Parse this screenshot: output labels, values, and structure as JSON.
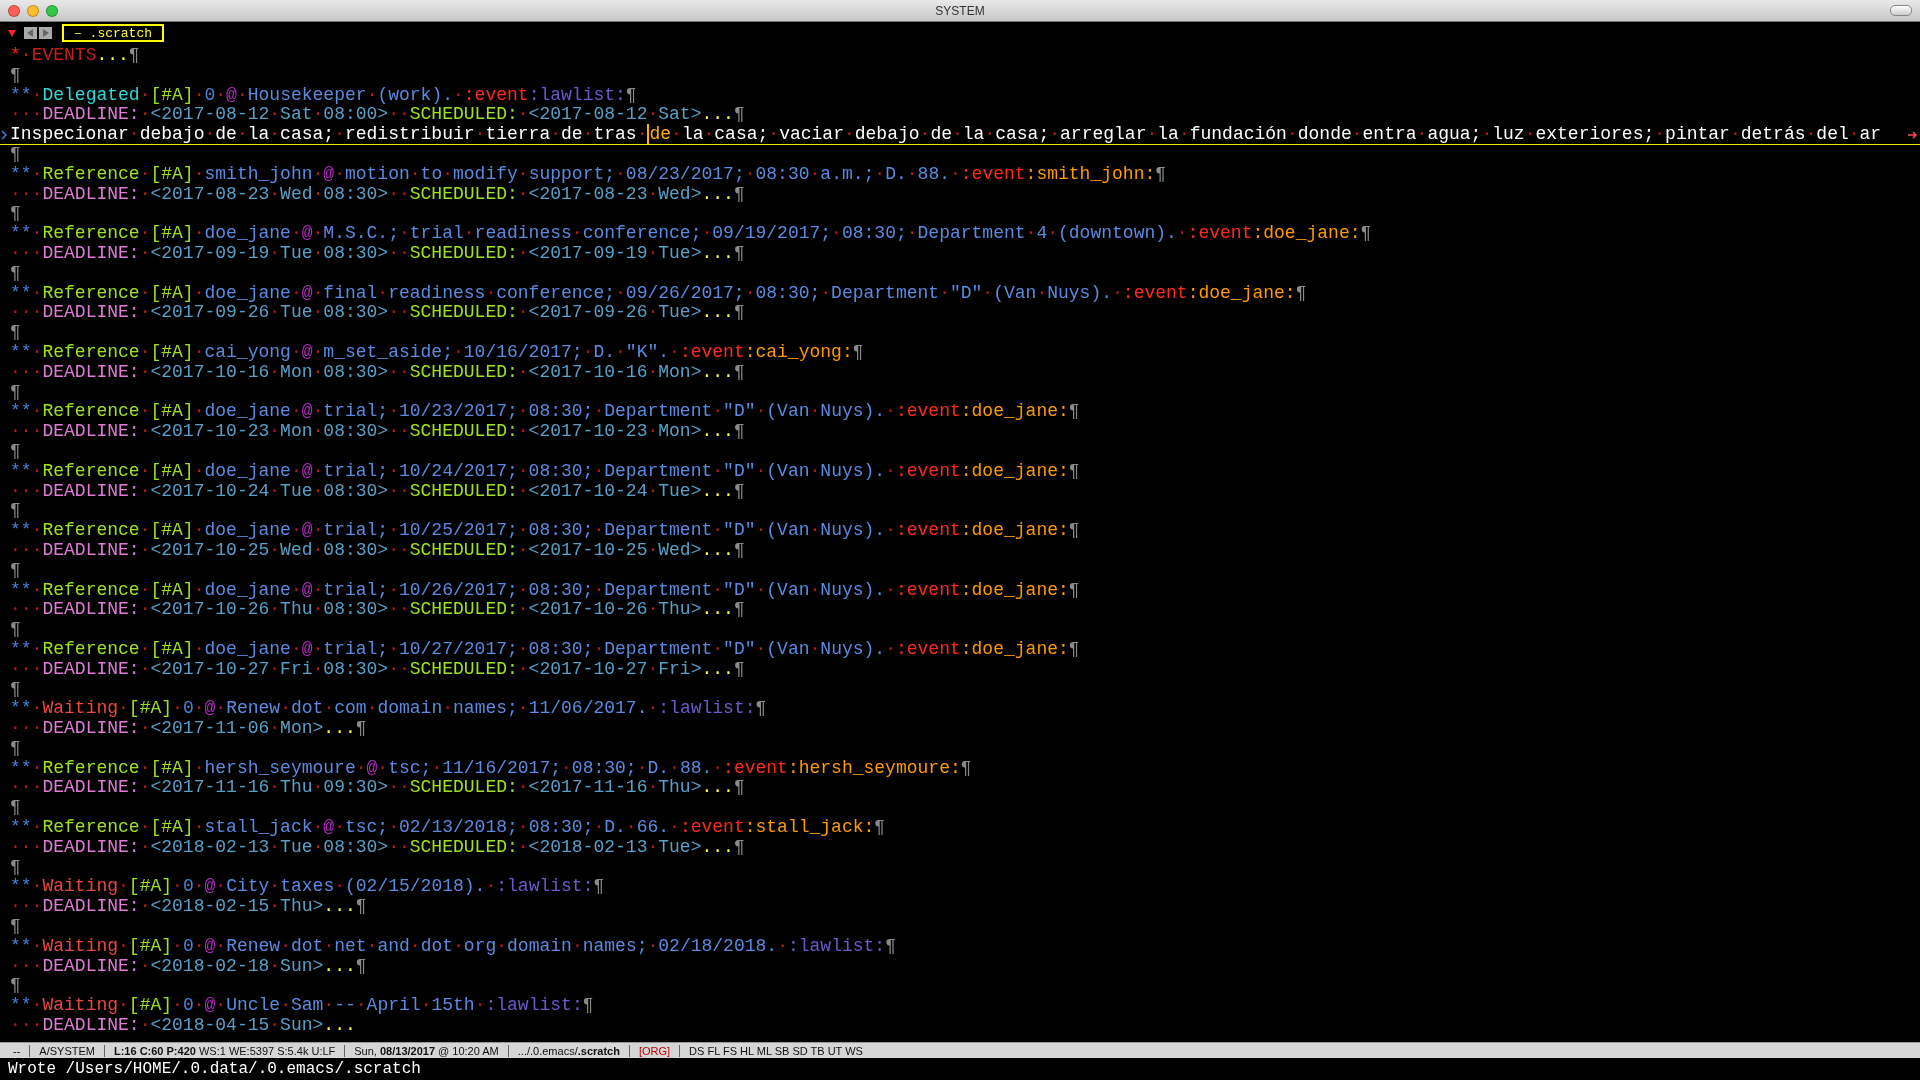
{
  "window": {
    "title": "SYSTEM"
  },
  "tab": {
    "label": "– .scratch",
    "selected": true
  },
  "lines": [
    {
      "kind": "heading",
      "segments": [
        {
          "kind": "star",
          "text": "*·"
        },
        {
          "kind": "events",
          "text": "EVENTS"
        },
        {
          "kind": "ellipsis",
          "text": "..."
        },
        {
          "kind": "pilcrow",
          "text": "¶"
        }
      ]
    },
    {
      "kind": "blank",
      "segments": [
        {
          "kind": "pilcrow",
          "text": "¶"
        }
      ]
    },
    {
      "kind": "heading",
      "segments": [
        {
          "kind": "stars",
          "text": "**·"
        },
        {
          "kind": "delegated",
          "text": "Delegated·"
        },
        {
          "kind": "priority",
          "text": "[#A]·"
        },
        {
          "kind": "count",
          "text": "0·"
        },
        {
          "kind": "at",
          "text": "@·"
        },
        {
          "kind": "title",
          "text": "Housekeeper·(work).·"
        },
        {
          "kind": "tag_event",
          "text": ":event"
        },
        {
          "kind": "tag_list",
          "text": ":lawlist:"
        },
        {
          "kind": "pilcrow",
          "text": "¶"
        }
      ]
    },
    {
      "kind": "planning",
      "segments": [
        {
          "kind": "indent",
          "text": "···"
        },
        {
          "kind": "deadline",
          "text": "DEADLINE:·"
        },
        {
          "kind": "timestamp",
          "text": "<2017-08-12·Sat·08:00>··"
        },
        {
          "kind": "scheduled",
          "text": "SCHEDULED:·"
        },
        {
          "kind": "timestamp",
          "text": "<2017-08-12·Sat>"
        },
        {
          "kind": "ellipsis",
          "text": "..."
        },
        {
          "kind": "pilcrow",
          "text": "¶"
        }
      ]
    },
    {
      "kind": "body",
      "segments": [
        {
          "kind": "body",
          "text": "Inspecionar·debajo·de·la·casa;·redistribuir·tierra·de·tras·"
        },
        {
          "kind": "cursor",
          "text": "de"
        },
        {
          "kind": "body",
          "text": "·la·casa;·vaciar·debajo·de·la·casa;·arreglar·la·fundación·donde·entra·agua;·luz·exteriores;·pintar·detrás·del·ar"
        }
      ]
    },
    {
      "kind": "blank",
      "segments": [
        {
          "kind": "pilcrow",
          "text": "¶"
        }
      ]
    },
    {
      "kind": "heading",
      "segments": [
        {
          "kind": "stars",
          "text": "**·"
        },
        {
          "kind": "reference",
          "text": "Reference·"
        },
        {
          "kind": "priority",
          "text": "[#A]·"
        },
        {
          "kind": "person",
          "text": "smith_john·"
        },
        {
          "kind": "at",
          "text": "@·"
        },
        {
          "kind": "title",
          "text": "motion·to·modify·support;·08/23/2017;·08:30·a.m.;·D.·88.·"
        },
        {
          "kind": "tag_event",
          "text": ":event"
        },
        {
          "kind": "tag_name",
          "text": ":smith_john:"
        },
        {
          "kind": "pilcrow",
          "text": "¶"
        }
      ]
    },
    {
      "kind": "planning",
      "segments": [
        {
          "kind": "indent",
          "text": "···"
        },
        {
          "kind": "deadline",
          "text": "DEADLINE:·"
        },
        {
          "kind": "timestamp",
          "text": "<2017-08-23·Wed·08:30>··"
        },
        {
          "kind": "scheduled",
          "text": "SCHEDULED:·"
        },
        {
          "kind": "timestamp",
          "text": "<2017-08-23·Wed>"
        },
        {
          "kind": "ellipsis",
          "text": "..."
        },
        {
          "kind": "pilcrow",
          "text": "¶"
        }
      ]
    },
    {
      "kind": "blank",
      "segments": [
        {
          "kind": "pilcrow",
          "text": "¶"
        }
      ]
    },
    {
      "kind": "heading",
      "segments": [
        {
          "kind": "stars",
          "text": "**·"
        },
        {
          "kind": "reference",
          "text": "Reference·"
        },
        {
          "kind": "priority",
          "text": "[#A]·"
        },
        {
          "kind": "person",
          "text": "doe_jane·"
        },
        {
          "kind": "at",
          "text": "@·"
        },
        {
          "kind": "title",
          "text": "M.S.C.;·trial·readiness·conference;·09/19/2017;·08:30;·Department·4·(downtown).·"
        },
        {
          "kind": "tag_event",
          "text": ":event"
        },
        {
          "kind": "tag_name",
          "text": ":doe_jane:"
        },
        {
          "kind": "pilcrow",
          "text": "¶"
        }
      ]
    },
    {
      "kind": "planning",
      "segments": [
        {
          "kind": "indent",
          "text": "···"
        },
        {
          "kind": "deadline",
          "text": "DEADLINE:·"
        },
        {
          "kind": "timestamp",
          "text": "<2017-09-19·Tue·08:30>··"
        },
        {
          "kind": "scheduled",
          "text": "SCHEDULED:·"
        },
        {
          "kind": "timestamp",
          "text": "<2017-09-19·Tue>"
        },
        {
          "kind": "ellipsis",
          "text": "..."
        },
        {
          "kind": "pilcrow",
          "text": "¶"
        }
      ]
    },
    {
      "kind": "blank",
      "segments": [
        {
          "kind": "pilcrow",
          "text": "¶"
        }
      ]
    },
    {
      "kind": "heading",
      "segments": [
        {
          "kind": "stars",
          "text": "**·"
        },
        {
          "kind": "reference",
          "text": "Reference·"
        },
        {
          "kind": "priority",
          "text": "[#A]·"
        },
        {
          "kind": "person",
          "text": "doe_jane·"
        },
        {
          "kind": "at",
          "text": "@·"
        },
        {
          "kind": "title",
          "text": "final·readiness·conference;·09/26/2017;·08:30;·Department·\"D\"·(Van·Nuys).·"
        },
        {
          "kind": "tag_event",
          "text": ":event"
        },
        {
          "kind": "tag_name",
          "text": ":doe_jane:"
        },
        {
          "kind": "pilcrow",
          "text": "¶"
        }
      ]
    },
    {
      "kind": "planning",
      "segments": [
        {
          "kind": "indent",
          "text": "···"
        },
        {
          "kind": "deadline",
          "text": "DEADLINE:·"
        },
        {
          "kind": "timestamp",
          "text": "<2017-09-26·Tue·08:30>··"
        },
        {
          "kind": "scheduled",
          "text": "SCHEDULED:·"
        },
        {
          "kind": "timestamp",
          "text": "<2017-09-26·Tue>"
        },
        {
          "kind": "ellipsis",
          "text": "..."
        },
        {
          "kind": "pilcrow",
          "text": "¶"
        }
      ]
    },
    {
      "kind": "blank",
      "segments": [
        {
          "kind": "pilcrow",
          "text": "¶"
        }
      ]
    },
    {
      "kind": "heading",
      "segments": [
        {
          "kind": "stars",
          "text": "**·"
        },
        {
          "kind": "reference",
          "text": "Reference·"
        },
        {
          "kind": "priority",
          "text": "[#A]·"
        },
        {
          "kind": "person",
          "text": "cai_yong·"
        },
        {
          "kind": "at",
          "text": "@·"
        },
        {
          "kind": "title",
          "text": "m_set_aside;·10/16/2017;·D.·\"K\".·"
        },
        {
          "kind": "tag_event",
          "text": ":event"
        },
        {
          "kind": "tag_name",
          "text": ":cai_yong:"
        },
        {
          "kind": "pilcrow",
          "text": "¶"
        }
      ]
    },
    {
      "kind": "planning",
      "segments": [
        {
          "kind": "indent",
          "text": "···"
        },
        {
          "kind": "deadline",
          "text": "DEADLINE:·"
        },
        {
          "kind": "timestamp",
          "text": "<2017-10-16·Mon·08:30>··"
        },
        {
          "kind": "scheduled",
          "text": "SCHEDULED:·"
        },
        {
          "kind": "timestamp",
          "text": "<2017-10-16·Mon>"
        },
        {
          "kind": "ellipsis",
          "text": "..."
        },
        {
          "kind": "pilcrow",
          "text": "¶"
        }
      ]
    },
    {
      "kind": "blank",
      "segments": [
        {
          "kind": "pilcrow",
          "text": "¶"
        }
      ]
    },
    {
      "kind": "heading",
      "segments": [
        {
          "kind": "stars",
          "text": "**·"
        },
        {
          "kind": "reference",
          "text": "Reference·"
        },
        {
          "kind": "priority",
          "text": "[#A]·"
        },
        {
          "kind": "person",
          "text": "doe_jane·"
        },
        {
          "kind": "at",
          "text": "@·"
        },
        {
          "kind": "title",
          "text": "trial;·10/23/2017;·08:30;·Department·\"D\"·(Van·Nuys).·"
        },
        {
          "kind": "tag_event",
          "text": ":event"
        },
        {
          "kind": "tag_name",
          "text": ":doe_jane:"
        },
        {
          "kind": "pilcrow",
          "text": "¶"
        }
      ]
    },
    {
      "kind": "planning",
      "segments": [
        {
          "kind": "indent",
          "text": "···"
        },
        {
          "kind": "deadline",
          "text": "DEADLINE:·"
        },
        {
          "kind": "timestamp",
          "text": "<2017-10-23·Mon·08:30>··"
        },
        {
          "kind": "scheduled",
          "text": "SCHEDULED:·"
        },
        {
          "kind": "timestamp",
          "text": "<2017-10-23·Mon>"
        },
        {
          "kind": "ellipsis",
          "text": "..."
        },
        {
          "kind": "pilcrow",
          "text": "¶"
        }
      ]
    },
    {
      "kind": "blank",
      "segments": [
        {
          "kind": "pilcrow",
          "text": "¶"
        }
      ]
    },
    {
      "kind": "heading",
      "segments": [
        {
          "kind": "stars",
          "text": "**·"
        },
        {
          "kind": "reference",
          "text": "Reference·"
        },
        {
          "kind": "priority",
          "text": "[#A]·"
        },
        {
          "kind": "person",
          "text": "doe_jane·"
        },
        {
          "kind": "at",
          "text": "@·"
        },
        {
          "kind": "title",
          "text": "trial;·10/24/2017;·08:30;·Department·\"D\"·(Van·Nuys).·"
        },
        {
          "kind": "tag_event",
          "text": ":event"
        },
        {
          "kind": "tag_name",
          "text": ":doe_jane:"
        },
        {
          "kind": "pilcrow",
          "text": "¶"
        }
      ]
    },
    {
      "kind": "planning",
      "segments": [
        {
          "kind": "indent",
          "text": "···"
        },
        {
          "kind": "deadline",
          "text": "DEADLINE:·"
        },
        {
          "kind": "timestamp",
          "text": "<2017-10-24·Tue·08:30>··"
        },
        {
          "kind": "scheduled",
          "text": "SCHEDULED:·"
        },
        {
          "kind": "timestamp",
          "text": "<2017-10-24·Tue>"
        },
        {
          "kind": "ellipsis",
          "text": "..."
        },
        {
          "kind": "pilcrow",
          "text": "¶"
        }
      ]
    },
    {
      "kind": "blank",
      "segments": [
        {
          "kind": "pilcrow",
          "text": "¶"
        }
      ]
    },
    {
      "kind": "heading",
      "segments": [
        {
          "kind": "stars",
          "text": "**·"
        },
        {
          "kind": "reference",
          "text": "Reference·"
        },
        {
          "kind": "priority",
          "text": "[#A]·"
        },
        {
          "kind": "person",
          "text": "doe_jane·"
        },
        {
          "kind": "at",
          "text": "@·"
        },
        {
          "kind": "title",
          "text": "trial;·10/25/2017;·08:30;·Department·\"D\"·(Van·Nuys).·"
        },
        {
          "kind": "tag_event",
          "text": ":event"
        },
        {
          "kind": "tag_name",
          "text": ":doe_jane:"
        },
        {
          "kind": "pilcrow",
          "text": "¶"
        }
      ]
    },
    {
      "kind": "planning",
      "segments": [
        {
          "kind": "indent",
          "text": "···"
        },
        {
          "kind": "deadline",
          "text": "DEADLINE:·"
        },
        {
          "kind": "timestamp",
          "text": "<2017-10-25·Wed·08:30>··"
        },
        {
          "kind": "scheduled",
          "text": "SCHEDULED:·"
        },
        {
          "kind": "timestamp",
          "text": "<2017-10-25·Wed>"
        },
        {
          "kind": "ellipsis",
          "text": "..."
        },
        {
          "kind": "pilcrow",
          "text": "¶"
        }
      ]
    },
    {
      "kind": "blank",
      "segments": [
        {
          "kind": "pilcrow",
          "text": "¶"
        }
      ]
    },
    {
      "kind": "heading",
      "segments": [
        {
          "kind": "stars",
          "text": "**·"
        },
        {
          "kind": "reference",
          "text": "Reference·"
        },
        {
          "kind": "priority",
          "text": "[#A]·"
        },
        {
          "kind": "person",
          "text": "doe_jane·"
        },
        {
          "kind": "at",
          "text": "@·"
        },
        {
          "kind": "title",
          "text": "trial;·10/26/2017;·08:30;·Department·\"D\"·(Van·Nuys).·"
        },
        {
          "kind": "tag_event",
          "text": ":event"
        },
        {
          "kind": "tag_name",
          "text": ":doe_jane:"
        },
        {
          "kind": "pilcrow",
          "text": "¶"
        }
      ]
    },
    {
      "kind": "planning",
      "segments": [
        {
          "kind": "indent",
          "text": "···"
        },
        {
          "kind": "deadline",
          "text": "DEADLINE:·"
        },
        {
          "kind": "timestamp",
          "text": "<2017-10-26·Thu·08:30>··"
        },
        {
          "kind": "scheduled",
          "text": "SCHEDULED:·"
        },
        {
          "kind": "timestamp",
          "text": "<2017-10-26·Thu>"
        },
        {
          "kind": "ellipsis",
          "text": "..."
        },
        {
          "kind": "pilcrow",
          "text": "¶"
        }
      ]
    },
    {
      "kind": "blank",
      "segments": [
        {
          "kind": "pilcrow",
          "text": "¶"
        }
      ]
    },
    {
      "kind": "heading",
      "segments": [
        {
          "kind": "stars",
          "text": "**·"
        },
        {
          "kind": "reference",
          "text": "Reference·"
        },
        {
          "kind": "priority",
          "text": "[#A]·"
        },
        {
          "kind": "person",
          "text": "doe_jane·"
        },
        {
          "kind": "at",
          "text": "@·"
        },
        {
          "kind": "title",
          "text": "trial;·10/27/2017;·08:30;·Department·\"D\"·(Van·Nuys).·"
        },
        {
          "kind": "tag_event",
          "text": ":event"
        },
        {
          "kind": "tag_name",
          "text": ":doe_jane:"
        },
        {
          "kind": "pilcrow",
          "text": "¶"
        }
      ]
    },
    {
      "kind": "planning",
      "segments": [
        {
          "kind": "indent",
          "text": "···"
        },
        {
          "kind": "deadline",
          "text": "DEADLINE:·"
        },
        {
          "kind": "timestamp",
          "text": "<2017-10-27·Fri·08:30>··"
        },
        {
          "kind": "scheduled",
          "text": "SCHEDULED:·"
        },
        {
          "kind": "timestamp",
          "text": "<2017-10-27·Fri>"
        },
        {
          "kind": "ellipsis",
          "text": "..."
        },
        {
          "kind": "pilcrow",
          "text": "¶"
        }
      ]
    },
    {
      "kind": "blank",
      "segments": [
        {
          "kind": "pilcrow",
          "text": "¶"
        }
      ]
    },
    {
      "kind": "heading",
      "segments": [
        {
          "kind": "stars",
          "text": "**·"
        },
        {
          "kind": "waiting",
          "text": "Waiting·"
        },
        {
          "kind": "priority",
          "text": "[#A]·"
        },
        {
          "kind": "count",
          "text": "0·"
        },
        {
          "kind": "at",
          "text": "@·"
        },
        {
          "kind": "title",
          "text": "Renew·dot·com·domain·names;·11/06/2017.·"
        },
        {
          "kind": "tag_list",
          "text": ":lawlist:"
        },
        {
          "kind": "pilcrow",
          "text": "¶"
        }
      ]
    },
    {
      "kind": "planning",
      "segments": [
        {
          "kind": "indent",
          "text": "···"
        },
        {
          "kind": "deadline",
          "text": "DEADLINE:·"
        },
        {
          "kind": "timestamp",
          "text": "<2017-11-06·Mon>"
        },
        {
          "kind": "ellipsis",
          "text": "..."
        },
        {
          "kind": "pilcrow",
          "text": "¶"
        }
      ]
    },
    {
      "kind": "blank",
      "segments": [
        {
          "kind": "pilcrow",
          "text": "¶"
        }
      ]
    },
    {
      "kind": "heading",
      "segments": [
        {
          "kind": "stars",
          "text": "**·"
        },
        {
          "kind": "reference",
          "text": "Reference·"
        },
        {
          "kind": "priority",
          "text": "[#A]·"
        },
        {
          "kind": "person",
          "text": "hersh_seymoure·"
        },
        {
          "kind": "at",
          "text": "@·"
        },
        {
          "kind": "title",
          "text": "tsc;·11/16/2017;·08:30;·D.·88.·"
        },
        {
          "kind": "tag_event",
          "text": ":event"
        },
        {
          "kind": "tag_name",
          "text": ":hersh_seymoure:"
        },
        {
          "kind": "pilcrow",
          "text": "¶"
        }
      ]
    },
    {
      "kind": "planning",
      "segments": [
        {
          "kind": "indent",
          "text": "···"
        },
        {
          "kind": "deadline",
          "text": "DEADLINE:·"
        },
        {
          "kind": "timestamp",
          "text": "<2017-11-16·Thu·09:30>··"
        },
        {
          "kind": "scheduled",
          "text": "SCHEDULED:·"
        },
        {
          "kind": "timestamp",
          "text": "<2017-11-16·Thu>"
        },
        {
          "kind": "ellipsis",
          "text": "..."
        },
        {
          "kind": "pilcrow",
          "text": "¶"
        }
      ]
    },
    {
      "kind": "blank",
      "segments": [
        {
          "kind": "pilcrow",
          "text": "¶"
        }
      ]
    },
    {
      "kind": "heading",
      "segments": [
        {
          "kind": "stars",
          "text": "**·"
        },
        {
          "kind": "reference",
          "text": "Reference·"
        },
        {
          "kind": "priority",
          "text": "[#A]·"
        },
        {
          "kind": "person",
          "text": "stall_jack·"
        },
        {
          "kind": "at",
          "text": "@·"
        },
        {
          "kind": "title",
          "text": "tsc;·02/13/2018;·08:30;·D.·66.·"
        },
        {
          "kind": "tag_event",
          "text": ":event"
        },
        {
          "kind": "tag_name",
          "text": ":stall_jack:"
        },
        {
          "kind": "pilcrow",
          "text": "¶"
        }
      ]
    },
    {
      "kind": "planning",
      "segments": [
        {
          "kind": "indent",
          "text": "···"
        },
        {
          "kind": "deadline",
          "text": "DEADLINE:·"
        },
        {
          "kind": "timestamp",
          "text": "<2018-02-13·Tue·08:30>··"
        },
        {
          "kind": "scheduled",
          "text": "SCHEDULED:·"
        },
        {
          "kind": "timestamp",
          "text": "<2018-02-13·Tue>"
        },
        {
          "kind": "ellipsis",
          "text": "..."
        },
        {
          "kind": "pilcrow",
          "text": "¶"
        }
      ]
    },
    {
      "kind": "blank",
      "segments": [
        {
          "kind": "pilcrow",
          "text": "¶"
        }
      ]
    },
    {
      "kind": "heading",
      "segments": [
        {
          "kind": "stars",
          "text": "**·"
        },
        {
          "kind": "waiting",
          "text": "Waiting·"
        },
        {
          "kind": "priority",
          "text": "[#A]·"
        },
        {
          "kind": "count",
          "text": "0·"
        },
        {
          "kind": "at",
          "text": "@·"
        },
        {
          "kind": "title",
          "text": "City·taxes·(02/15/2018).·"
        },
        {
          "kind": "tag_list",
          "text": ":lawlist:"
        },
        {
          "kind": "pilcrow",
          "text": "¶"
        }
      ]
    },
    {
      "kind": "planning",
      "segments": [
        {
          "kind": "indent",
          "text": "···"
        },
        {
          "kind": "deadline",
          "text": "DEADLINE:·"
        },
        {
          "kind": "timestamp",
          "text": "<2018-02-15·Thu>"
        },
        {
          "kind": "ellipsis",
          "text": "..."
        },
        {
          "kind": "pilcrow",
          "text": "¶"
        }
      ]
    },
    {
      "kind": "blank",
      "segments": [
        {
          "kind": "pilcrow",
          "text": "¶"
        }
      ]
    },
    {
      "kind": "heading",
      "segments": [
        {
          "kind": "stars",
          "text": "**·"
        },
        {
          "kind": "waiting",
          "text": "Waiting·"
        },
        {
          "kind": "priority",
          "text": "[#A]·"
        },
        {
          "kind": "count",
          "text": "0·"
        },
        {
          "kind": "at",
          "text": "@·"
        },
        {
          "kind": "title",
          "text": "Renew·dot·net·and·dot·org·domain·names;·02/18/2018.·"
        },
        {
          "kind": "tag_list",
          "text": ":lawlist:"
        },
        {
          "kind": "pilcrow",
          "text": "¶"
        }
      ]
    },
    {
      "kind": "planning",
      "segments": [
        {
          "kind": "indent",
          "text": "···"
        },
        {
          "kind": "deadline",
          "text": "DEADLINE:·"
        },
        {
          "kind": "timestamp",
          "text": "<2018-02-18·Sun>"
        },
        {
          "kind": "ellipsis",
          "text": "..."
        },
        {
          "kind": "pilcrow",
          "text": "¶"
        }
      ]
    },
    {
      "kind": "blank",
      "segments": [
        {
          "kind": "pilcrow",
          "text": "¶"
        }
      ]
    },
    {
      "kind": "heading",
      "segments": [
        {
          "kind": "stars",
          "text": "**·"
        },
        {
          "kind": "waiting",
          "text": "Waiting·"
        },
        {
          "kind": "priority",
          "text": "[#A]·"
        },
        {
          "kind": "count",
          "text": "0·"
        },
        {
          "kind": "at",
          "text": "@·"
        },
        {
          "kind": "title",
          "text": "Uncle·Sam·--·April·15th·"
        },
        {
          "kind": "tag_list",
          "text": ":lawlist:"
        },
        {
          "kind": "pilcrow",
          "text": "¶"
        }
      ]
    },
    {
      "kind": "planning",
      "segments": [
        {
          "kind": "indent",
          "text": "···"
        },
        {
          "kind": "deadline",
          "text": "DEADLINE:·"
        },
        {
          "kind": "timestamp",
          "text": "<2018-04-15·Sun>"
        },
        {
          "kind": "ellipsis",
          "text": "..."
        }
      ]
    }
  ],
  "mode_line": [
    {
      "kind": "plain",
      "text": "--"
    },
    {
      "kind": "plain",
      "text": "A/SYSTEM"
    },
    {
      "kind": "plain",
      "text": "**L:16 C:60 P:420** WS:1 WE:5397 S:5.4k U:LF"
    },
    {
      "kind": "plain",
      "text": "Sun, **08/13/2017** @ 10:20 AM"
    },
    {
      "kind": "plain",
      "text": ".../.0.emacs/**.scratch**"
    },
    {
      "kind": "mode",
      "text": "[ORG]"
    },
    {
      "kind": "plain",
      "text": "DS FL FS HL ML SB SD TB UT WS"
    }
  ],
  "echo_area": "Wrote /Users/HOME/.0.data/.0.emacs/.scratch"
}
